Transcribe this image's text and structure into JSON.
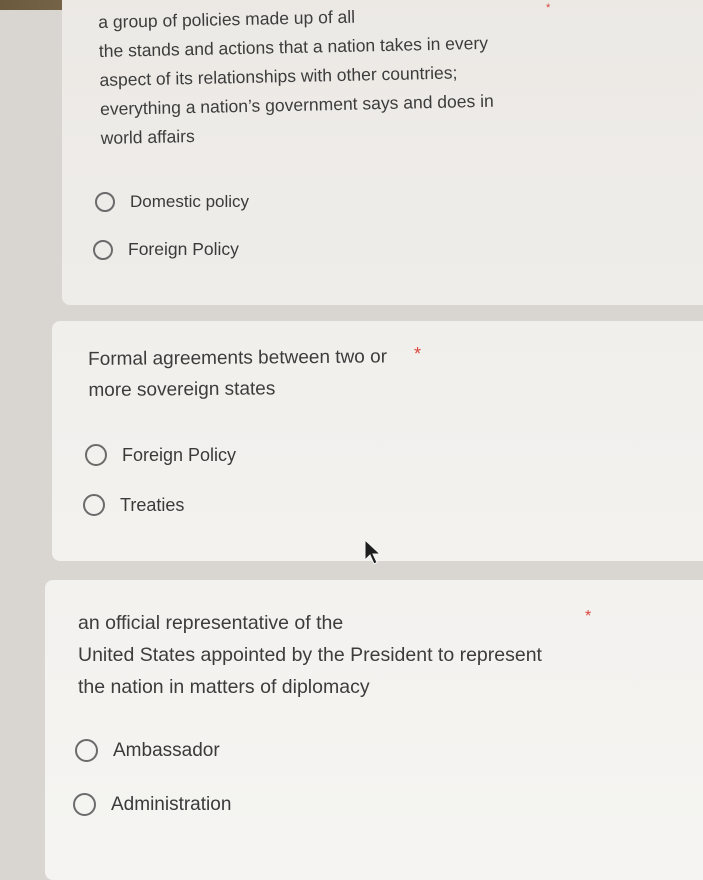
{
  "questions": [
    {
      "lines": [
        "a group of policies made up of all",
        "the stands and actions that a nation takes in every",
        "aspect of its relationships with other countries;",
        "everything a nation’s government says and does in",
        "world affairs"
      ],
      "required_mark": "*",
      "options": [
        "Domestic policy",
        "Foreign Policy"
      ]
    },
    {
      "lines": [
        "Formal agreements between two or",
        "more sovereign states"
      ],
      "required_mark": "*",
      "options": [
        "Foreign Policy",
        "Treaties"
      ]
    },
    {
      "lines": [
        "an official representative of the",
        "United States appointed by the President to represent",
        "the nation in matters of diplomacy"
      ],
      "required_mark": "*",
      "options": [
        "Ambassador",
        "Administration"
      ]
    }
  ],
  "colors": {
    "required": "#d9443a",
    "card": "#f0eeeb",
    "background": "#d9d6d2",
    "radio_border": "#6b6b6b"
  }
}
